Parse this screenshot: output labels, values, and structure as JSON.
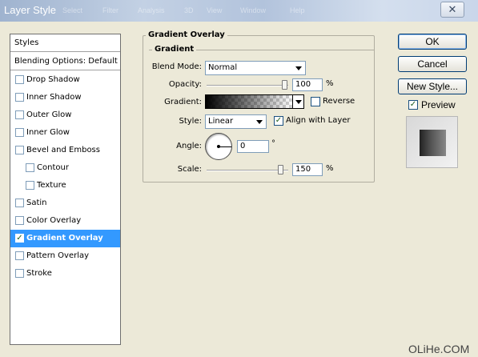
{
  "window": {
    "title": "Layer Style",
    "close_glyph": "✕",
    "background_menu": [
      "Select",
      "Filter",
      "Analysis",
      "3D",
      "View",
      "Window",
      "Help"
    ]
  },
  "styles_panel": {
    "header": "Styles",
    "blending": "Blending Options: Default",
    "items": [
      {
        "label": "Drop Shadow",
        "checked": false
      },
      {
        "label": "Inner Shadow",
        "checked": false
      },
      {
        "label": "Outer Glow",
        "checked": false
      },
      {
        "label": "Inner Glow",
        "checked": false
      },
      {
        "label": "Bevel and Emboss",
        "checked": false
      },
      {
        "label": "Contour",
        "checked": false,
        "indent": true
      },
      {
        "label": "Texture",
        "checked": false,
        "indent": true
      },
      {
        "label": "Satin",
        "checked": false
      },
      {
        "label": "Color Overlay",
        "checked": false
      },
      {
        "label": "Gradient Overlay",
        "checked": true,
        "selected": true
      },
      {
        "label": "Pattern Overlay",
        "checked": false
      },
      {
        "label": "Stroke",
        "checked": false
      }
    ],
    "check_glyph": "✓"
  },
  "gradient_overlay": {
    "section_title": "Gradient Overlay",
    "group_title": "Gradient",
    "blend_mode_label": "Blend Mode:",
    "blend_mode_value": "Normal",
    "opacity_label": "Opacity:",
    "opacity_value": "100",
    "opacity_unit": "%",
    "opacity_level": 1.0,
    "gradient_label": "Gradient:",
    "reverse_label": "Reverse",
    "reverse_checked": false,
    "style_label": "Style:",
    "style_value": "Linear",
    "align_label": "Align with Layer",
    "align_checked": true,
    "angle_label": "Angle:",
    "angle_value": "0",
    "angle_unit": "°",
    "scale_label": "Scale:",
    "scale_value": "150",
    "scale_unit": "%",
    "scale_level": 0.95
  },
  "buttons": {
    "ok": "OK",
    "cancel": "Cancel",
    "new_style": "New Style...",
    "preview_label": "Preview",
    "preview_checked": true
  },
  "watermark": "OLiHe.COM",
  "colors": {
    "selection": "#3399ff",
    "dialog_bg": "#ece9d8",
    "title_bar": "#b2c3dc"
  }
}
